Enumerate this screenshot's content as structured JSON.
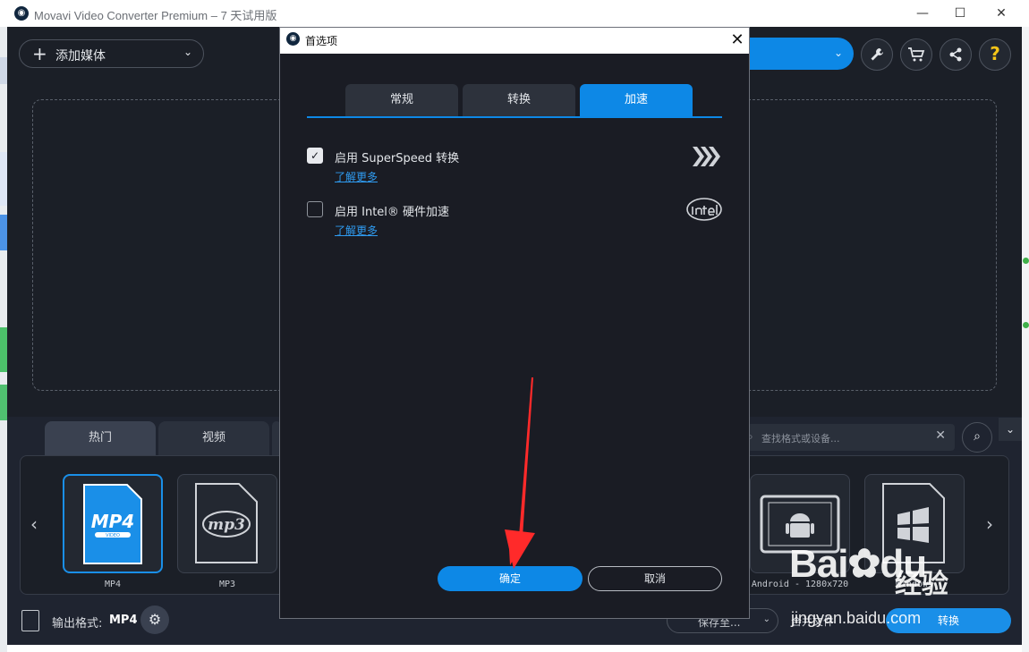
{
  "window": {
    "title": "Movavi Video Converter Premium – 7 天试用版",
    "minimize_glyph": "—",
    "maximize_glyph": "☐",
    "close_glyph": "✕"
  },
  "toolbar": {
    "add_media_label": "添加媒体",
    "add_media_plus": "+",
    "chevron": "⌄",
    "icons": [
      "wrench-icon",
      "cart-icon",
      "share-icon",
      "help-icon"
    ],
    "help_glyph": "?"
  },
  "format_tabs": [
    "热门",
    "视频"
  ],
  "format_search": {
    "placeholder": "查找格式或设备...",
    "clear": "✕"
  },
  "formats": [
    {
      "label": "MP4",
      "icon_text": "MP4",
      "icon_sub": "VIDEO",
      "selected": true
    },
    {
      "label": "MP3",
      "icon_text": "mp3",
      "selected": false
    },
    {
      "label": "Android - 1280x720",
      "selected": false
    },
    {
      "label": "Windows",
      "selected": false
    }
  ],
  "output": {
    "label": "输出格式:",
    "value": "MP4",
    "save_to": "保存至...",
    "merge": "合并文件",
    "start": "转换"
  },
  "dialog": {
    "title": "首选项",
    "close": "✕",
    "tabs": [
      {
        "label": "常规",
        "active": false
      },
      {
        "label": "转换",
        "active": false
      },
      {
        "label": "加速",
        "active": true
      }
    ],
    "options": [
      {
        "label": "启用 SuperSpeed 转换",
        "checked": true,
        "link": "了解更多",
        "icon": "superspeed-icon"
      },
      {
        "label": "启用 Intel® 硬件加速",
        "checked": false,
        "link": "了解更多",
        "icon": "intel-icon"
      }
    ],
    "ok": "确定",
    "cancel": "取消",
    "check_glyph": "✓"
  },
  "watermark": {
    "brand": "Bai",
    "brand_suffix": "du",
    "chinese": "经验",
    "url": "jingyan.baidu.com"
  },
  "colors": {
    "accent": "#0d88e6",
    "app_bg": "#1b1f27",
    "dialog_bg": "#1a1c24",
    "arrow": "#ff2a2a"
  }
}
